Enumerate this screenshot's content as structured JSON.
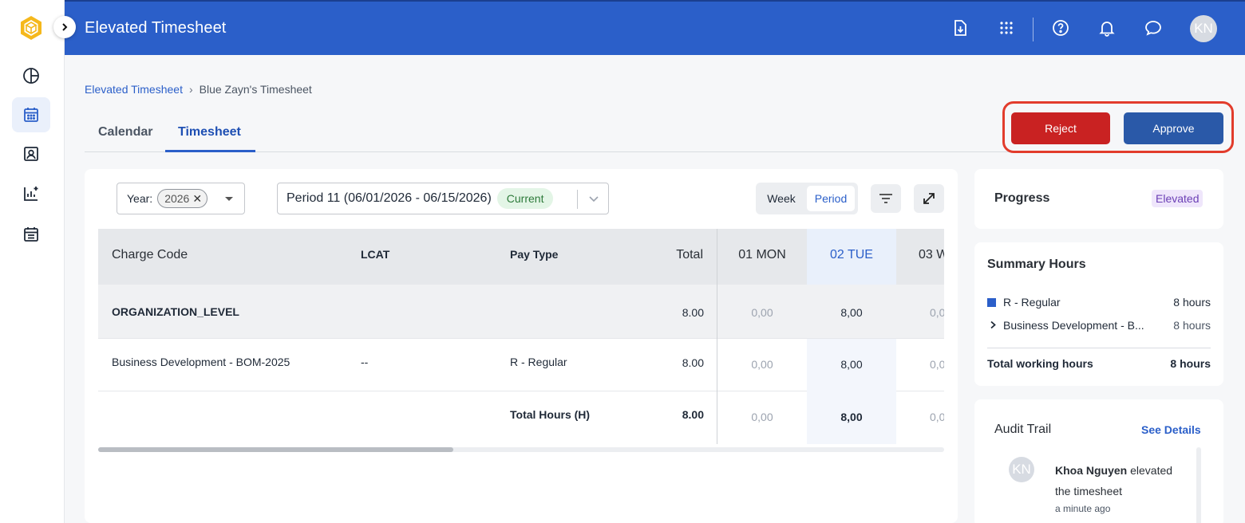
{
  "header": {
    "title": "Elevated Timesheet",
    "avatar_initials": "KN",
    "icons": [
      "export-icon",
      "apps-grid-icon",
      "help-icon",
      "bell-icon",
      "chat-icon"
    ]
  },
  "sidebar": {
    "items": [
      "dashboard-icon",
      "calendar-icon",
      "contact-card-icon",
      "reports-icon",
      "schedule-icon"
    ],
    "active_index": 1
  },
  "breadcrumb": {
    "root": "Elevated Timesheet",
    "separator": "›",
    "current": "Blue Zayn's Timesheet"
  },
  "tabs": [
    "Calendar",
    "Timesheet"
  ],
  "active_tab": "Timesheet",
  "actions": {
    "reject_label": "Reject",
    "approve_label": "Approve"
  },
  "filters": {
    "year_label": "Year:",
    "year_value": "2026",
    "period_value": "Period 11 (06/01/2026 - 06/15/2026)",
    "period_badge": "Current",
    "view_options": [
      "Week",
      "Period"
    ],
    "selected_view": "Period"
  },
  "table": {
    "columns": {
      "charge_code": "Charge Code",
      "lcat": "LCAT",
      "pay_type": "Pay Type",
      "total": "Total",
      "days": [
        "01 MON",
        "02 TUE",
        "03 W"
      ]
    },
    "org_row": {
      "charge_code": "ORGANIZATION_LEVEL",
      "total": "8.00",
      "days": [
        "0,00",
        "8,00",
        "0,0"
      ]
    },
    "rows": [
      {
        "charge_code": "Business Development - BOM-2025",
        "lcat": "--",
        "pay_type": "R - Regular",
        "total": "8.00",
        "days": [
          "0,00",
          "8,00",
          "0,0"
        ]
      }
    ],
    "total_row": {
      "label": "Total Hours (H)",
      "total": "8.00",
      "days": [
        "0,00",
        "8,00",
        "0,0"
      ]
    }
  },
  "progress": {
    "title": "Progress",
    "status": "Elevated",
    "status_color": "#6b3fb5"
  },
  "summary": {
    "title": "Summary Hours",
    "regular_label": "R - Regular",
    "regular_hours": "8 hours",
    "detail_label": "Business Development - B...",
    "detail_hours": "8 hours",
    "total_label": "Total working hours",
    "total_hours": "8 hours"
  },
  "audit": {
    "title": "Audit Trail",
    "see_details": "See Details",
    "entry": {
      "avatar": "KN",
      "name": "Khoa Nguyen",
      "action": "elevated the timesheet",
      "time": "a minute ago"
    }
  },
  "colors": {
    "header_blue": "#2b5fc9",
    "reject_red": "#c92222",
    "approve_blue": "#2a59a8",
    "highlight_frame": "#e23c2c"
  }
}
